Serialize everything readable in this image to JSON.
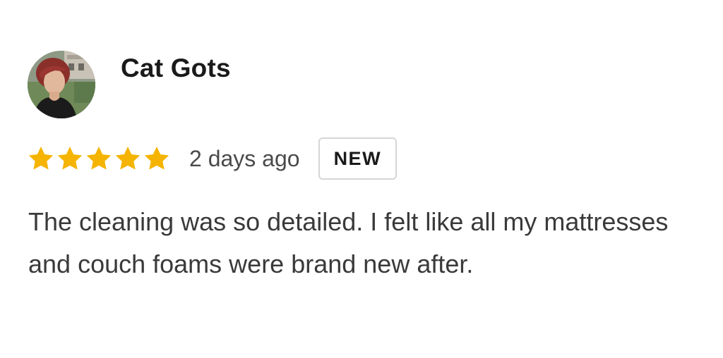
{
  "review": {
    "reviewer_name": "Cat Gots",
    "rating": 5,
    "rating_max": 5,
    "timestamp": "2 days ago",
    "badge": "NEW",
    "text": "The cleaning was so detailed. I felt like all my mattresses and couch foams were brand new after.",
    "star_color": "#f5b400"
  },
  "icons": {
    "avatar": "reviewer-photo",
    "star": "star-icon"
  }
}
